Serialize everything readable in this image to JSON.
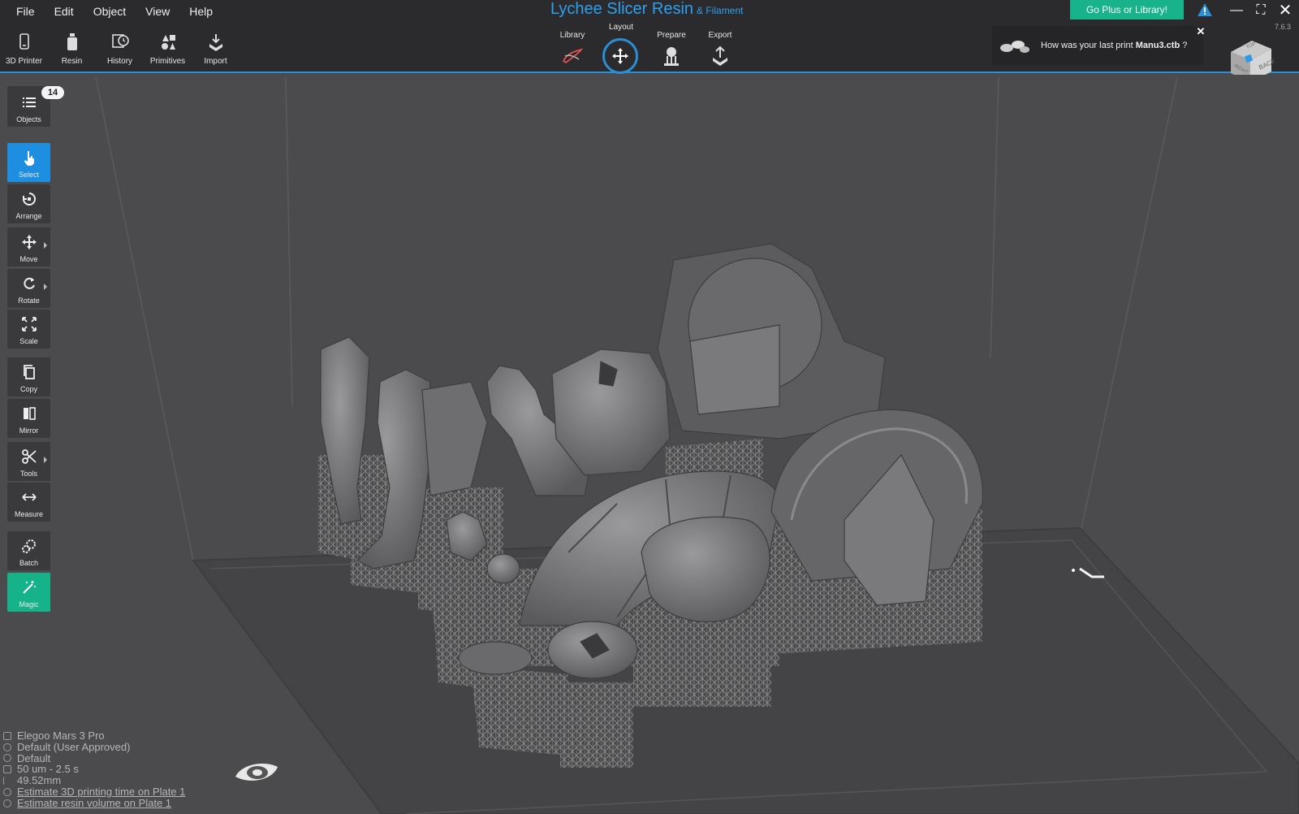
{
  "menu": [
    "File",
    "Edit",
    "Object",
    "View",
    "Help"
  ],
  "app_title": "Lychee Slicer Resin",
  "app_subtitle": "& Filament",
  "top_tools": [
    {
      "label": "3D Printer",
      "icon": "printer-icon"
    },
    {
      "label": "Resin",
      "icon": "resin-bottle-icon"
    },
    {
      "label": "History",
      "icon": "history-icon"
    },
    {
      "label": "Primitives",
      "icon": "primitives-icon"
    },
    {
      "label": "Import",
      "icon": "import-icon"
    }
  ],
  "workflow": [
    {
      "label": "Library",
      "icon": "library-icon"
    },
    {
      "label": "Layout",
      "icon": "move-arrows-icon",
      "active": true
    },
    {
      "label": "Prepare",
      "icon": "supports-icon"
    },
    {
      "label": "Export",
      "icon": "export-icon"
    }
  ],
  "plus_button": "Go Plus or Library!",
  "version": "7.6.3",
  "notice": {
    "prefix": "How was your last print ",
    "file": "Manu3.ctb",
    "suffix": " ?"
  },
  "view_cube": {
    "faces": [
      "BACK",
      "RIGHT",
      "TOP"
    ]
  },
  "objects_count": "14",
  "side_tools": [
    {
      "label": "Objects",
      "icon": "list-icon"
    },
    {
      "label": "Select",
      "icon": "pointer-hand-icon",
      "active": true
    },
    {
      "label": "Arrange",
      "icon": "arrange-icon"
    },
    {
      "label": "Move",
      "icon": "move-icon",
      "submenu": true
    },
    {
      "label": "Rotate",
      "icon": "rotate-icon",
      "submenu": true
    },
    {
      "label": "Scale",
      "icon": "scale-icon"
    },
    {
      "label": "Copy",
      "icon": "copy-icon"
    },
    {
      "label": "Mirror",
      "icon": "mirror-icon"
    },
    {
      "label": "Tools",
      "icon": "scissors-icon",
      "submenu": true
    },
    {
      "label": "Measure",
      "icon": "measure-icon"
    },
    {
      "label": "Batch",
      "icon": "batch-icon"
    },
    {
      "label": "Magic",
      "icon": "magic-wand-icon"
    }
  ],
  "info": {
    "printer": "Elegoo Mars 3 Pro",
    "resin": "Default (User Approved)",
    "profile": "Default",
    "layer": "50 um - 2.5 s",
    "height": "49.52mm",
    "est_time": "Estimate 3D printing time on Plate 1",
    "est_volume": "Estimate resin volume on Plate 1"
  },
  "colors": {
    "accent": "#2a8fd6",
    "plus": "#18b38a",
    "topbar": "#2b2b2d",
    "viewport": "#4a4a4c"
  }
}
